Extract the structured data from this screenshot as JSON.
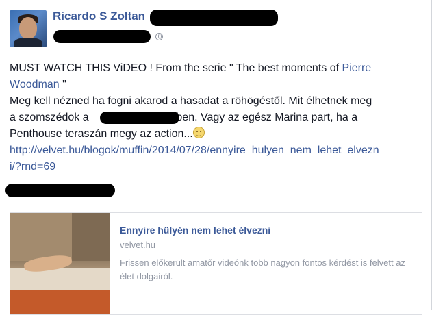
{
  "post": {
    "author": "Ricardo S Zoltan",
    "privacy_icon": "globe-icon",
    "text": {
      "line1_prefix": "MUST WATCH THIS ViDEO ! From the serie \" The best moments of ",
      "line1_link": "Pierre",
      "line2_link": "Woodman",
      "line2_suffix": " \"",
      "line3": "Meg kell nézned ha fogni akarod a hasadat a röhögéstől. Mit élhetnek meg",
      "line4_prefix": "a szomszédok a ",
      "line4_suffix": "-ben. Vagy az egész Marina part, ha a",
      "line5": "Penthouse teraszán megy az action...",
      "url_line1": "http://velvet.hu/blogok/muffin/2014/07/28/ennyire_hulyen_nem_lehet_elvezn",
      "url_line2": "i/?rnd=69"
    }
  },
  "link_card": {
    "title": "Ennyire hülyén nem lehet élvezni",
    "domain": "velvet.hu",
    "description": "Frissen előkerült amatőr videónk több nagyon fontos kérdést is felvett az élet dolgairól."
  },
  "colors": {
    "link": "#3b5998",
    "text": "#141823",
    "muted": "#9197a3"
  }
}
